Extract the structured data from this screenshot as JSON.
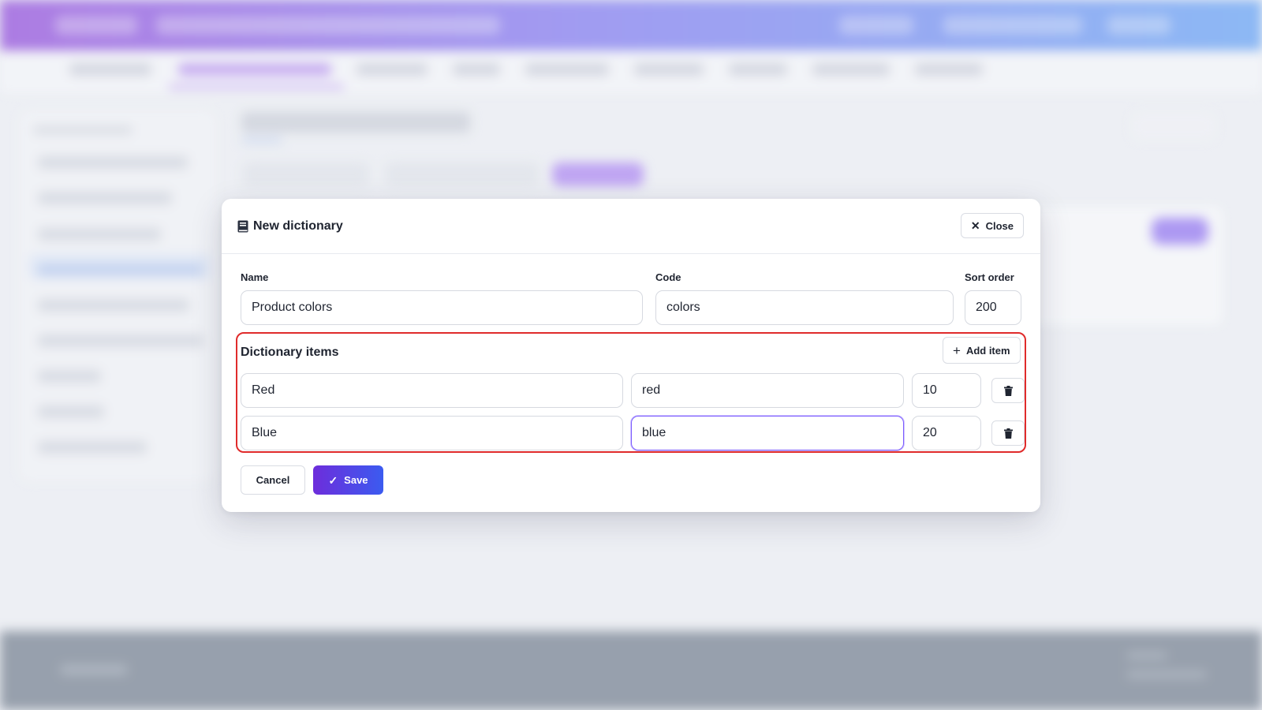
{
  "modal": {
    "title": "New dictionary",
    "title_icon": "book-icon",
    "close_label": "Close",
    "close_icon": "close-icon",
    "fields": {
      "name_label": "Name",
      "name_value": "Product colors",
      "code_label": "Code",
      "code_value": "colors",
      "sort_label": "Sort order",
      "sort_value": "200"
    },
    "items_section": {
      "title": "Dictionary items",
      "add_label": "Add item",
      "add_icon": "plus-icon",
      "highlight_color": "#e02b2b",
      "items": [
        {
          "name": "Red",
          "code": "red",
          "sort": "10"
        },
        {
          "name": "Blue",
          "code": "blue",
          "sort": "20"
        }
      ]
    },
    "cancel_label": "Cancel",
    "save_label": "Save",
    "save_icon": "check-icon",
    "accent_gradient": [
      "#6d2ddb",
      "#3b5bf0"
    ]
  }
}
